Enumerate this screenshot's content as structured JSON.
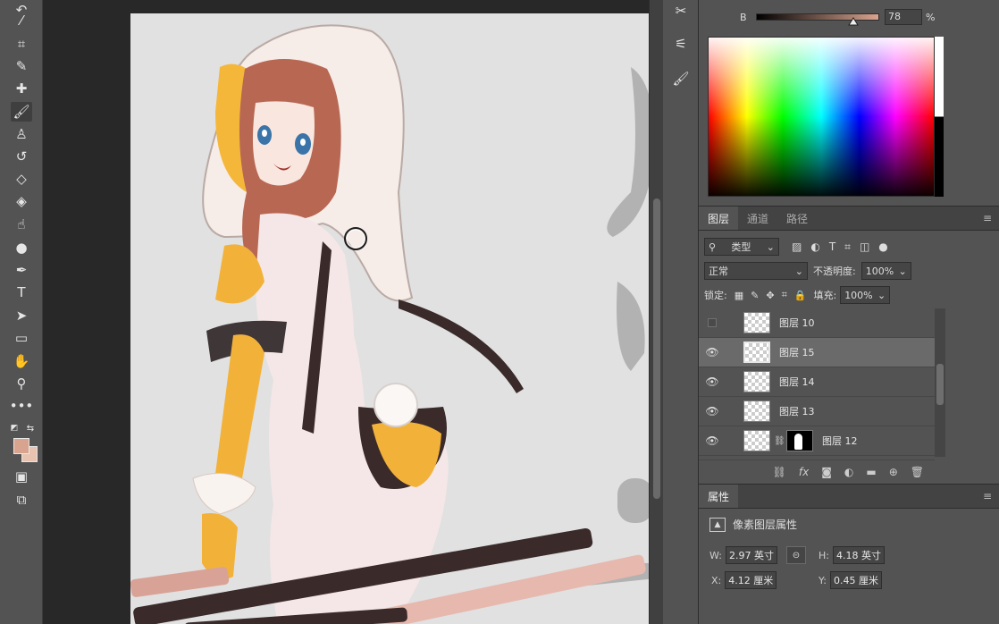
{
  "colors": {
    "foreground": "#d9a48f",
    "background": "#e8c3b0",
    "canvas_bg": "#e1e1e1",
    "ui_bg": "#535353"
  },
  "toolbar": {
    "tools": [
      "lasso-icon",
      "magic-wand-icon",
      "crop-icon",
      "eyedropper-icon",
      "healing-brush-icon",
      "brush-icon",
      "clone-stamp-icon",
      "history-brush-icon",
      "eraser-icon",
      "paint-bucket-icon",
      "dodge-icon",
      "smudge-icon",
      "pen-icon",
      "type-icon",
      "path-select-icon",
      "rectangle-icon",
      "hand-icon",
      "zoom-icon",
      "more-tools-icon"
    ],
    "type_tool_label": "T"
  },
  "color_panel": {
    "slider_label": "B",
    "slider_value": "78",
    "slider_fraction": 0.78,
    "percent_sign": "%"
  },
  "layers_panel": {
    "tabs": [
      {
        "label": "图层",
        "active": true
      },
      {
        "label": "通道",
        "active": false
      },
      {
        "label": "路径",
        "active": false
      }
    ],
    "filter_kind": "类型",
    "blend_mode": "正常",
    "opacity_label": "不透明度:",
    "opacity_value": "100%",
    "lock_label": "锁定:",
    "fill_label": "填充:",
    "fill_value": "100%",
    "layers": [
      {
        "name": "图层 10",
        "visible": false,
        "selected": false,
        "mask": false
      },
      {
        "name": "图层 15",
        "visible": true,
        "selected": true,
        "mask": false
      },
      {
        "name": "图层 14",
        "visible": true,
        "selected": false,
        "mask": false
      },
      {
        "name": "图层 13",
        "visible": true,
        "selected": false,
        "mask": false
      },
      {
        "name": "图层 12",
        "visible": true,
        "selected": false,
        "mask": true
      }
    ],
    "footer_fx": "fx"
  },
  "properties_panel": {
    "tab": "属性",
    "subtitle": "像素图层属性",
    "w_label": "W:",
    "w_value": "2.97 英寸",
    "h_label": "H:",
    "h_value": "4.18 英寸",
    "x_label": "X:",
    "x_value": "4.12 厘米",
    "y_label": "Y:",
    "y_value": "0.45 厘米"
  }
}
